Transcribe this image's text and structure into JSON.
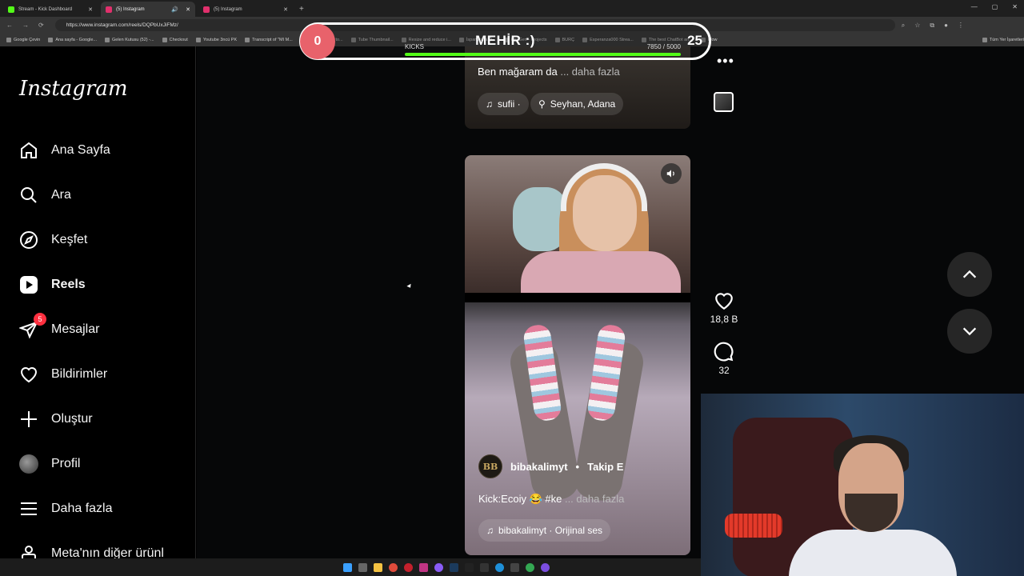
{
  "browser": {
    "tabs": [
      {
        "title": "Stream - Kick Dashboard",
        "favicon_color": "#53fc18",
        "active": false
      },
      {
        "title": "(5) Instagram",
        "favicon_color": "#e1306c",
        "active": true
      },
      {
        "title": "(5) Instagram",
        "favicon_color": "#e1306c",
        "active": false
      }
    ],
    "url": "https://www.instagram.com/reels/DQPbUxJiFMz/",
    "bookmarks": [
      "Google Çevin",
      "Ana sayfa - Google...",
      "Gelen Kutusu (52) -...",
      "Checkout",
      "Youtube 3ncü PK",
      "Transcript of \"MI M...",
      "CapCut | Text to...",
      "Tube Thumbnail...",
      "Resize and reduce i...",
      "İspanyolca Ö...",
      "HeyGen - Projects",
      "BURÇ",
      "Esperanza000 Strea...",
      "The best ChatBot an...",
      "Flow",
      "Tüm Yer İşaretleri"
    ]
  },
  "overlay": {
    "left_count": "0",
    "name": "MEHİR :)",
    "right_count": "25",
    "kicks_label": "KICKS",
    "kicks_progress": "7850  / 5000",
    "kicks_fill": 1.0,
    "accent": "#53fc18"
  },
  "sidebar": {
    "logo": "Instagram",
    "items": [
      {
        "label": "Ana Sayfa",
        "icon": "home-icon"
      },
      {
        "label": "Ara",
        "icon": "search-icon"
      },
      {
        "label": "Keşfet",
        "icon": "explore-icon"
      },
      {
        "label": "Reels",
        "icon": "reels-icon"
      },
      {
        "label": "Mesajlar",
        "icon": "messages-icon",
        "badge": "5"
      },
      {
        "label": "Bildirimler",
        "icon": "heart-icon"
      },
      {
        "label": "Oluştur",
        "icon": "plus-icon"
      },
      {
        "label": "Profil",
        "icon": "avatar"
      },
      {
        "label": "Daha fazla",
        "icon": "menu-icon"
      },
      {
        "label": "Meta'nın diğer ürünl",
        "icon": "meta-icon"
      }
    ]
  },
  "reel_top": {
    "caption": "Ben mağaram da",
    "more": " ... daha fazla",
    "audio": "sufii ·",
    "location": "Seyhan, Adana"
  },
  "reel": {
    "username": "bibakalimyt",
    "follow": "Takip E",
    "caption": "Kick:Ecoiy 😂 #ke",
    "more": " ... daha fazla",
    "audio": "bibakalimyt · Orijinal ses",
    "likes": "18,8 B",
    "comments": "32",
    "avatar_letters": "BB"
  },
  "colors": {
    "badge": "#ff3040",
    "sidebar_bg": "#000000"
  }
}
